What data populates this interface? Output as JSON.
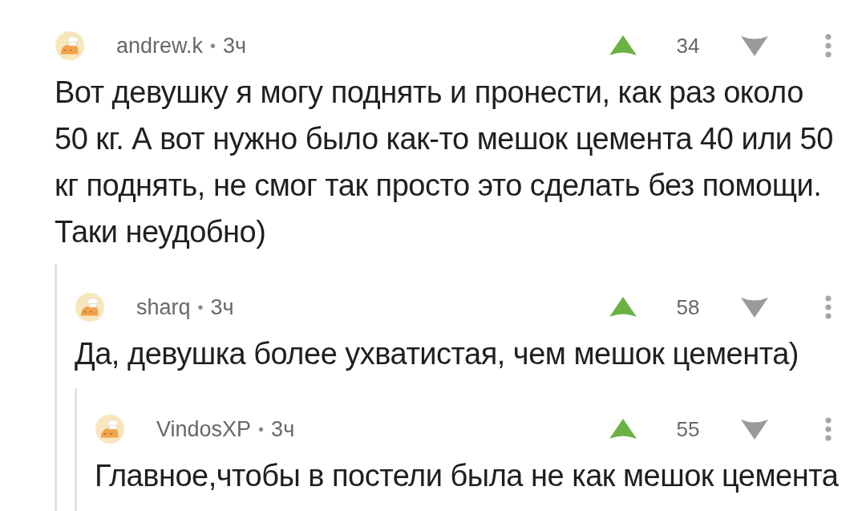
{
  "comments": [
    {
      "author": "andrew.k",
      "separator": "•",
      "time": "3ч",
      "score": "34",
      "text": "Вот девушку я могу поднять и пронести, как раз около 50 кг. А вот нужно было как-то мешок цемента 40 или 50 кг поднять, не смог так просто это сделать без помощи. Таки неудобно)",
      "replies": [
        {
          "author": "sharq",
          "separator": "•",
          "time": "3ч",
          "score": "58",
          "text": "Да, девушка более ухватистая, чем мешок цемента)",
          "replies": [
            {
              "author": "VindosXP",
              "separator": "•",
              "time": "3ч",
              "score": "55",
              "text": "Главное,чтобы в постели была не как мешок цемента"
            }
          ]
        }
      ]
    }
  ]
}
